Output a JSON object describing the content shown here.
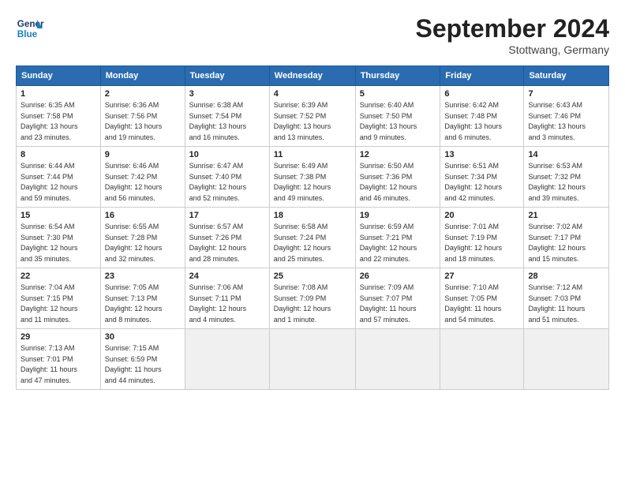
{
  "header": {
    "logo_line1": "General",
    "logo_line2": "Blue",
    "month_title": "September 2024",
    "location": "Stottwang, Germany"
  },
  "weekdays": [
    "Sunday",
    "Monday",
    "Tuesday",
    "Wednesday",
    "Thursday",
    "Friday",
    "Saturday"
  ],
  "weeks": [
    [
      {
        "day": "1",
        "info": "Sunrise: 6:35 AM\nSunset: 7:58 PM\nDaylight: 13 hours\nand 23 minutes."
      },
      {
        "day": "2",
        "info": "Sunrise: 6:36 AM\nSunset: 7:56 PM\nDaylight: 13 hours\nand 19 minutes."
      },
      {
        "day": "3",
        "info": "Sunrise: 6:38 AM\nSunset: 7:54 PM\nDaylight: 13 hours\nand 16 minutes."
      },
      {
        "day": "4",
        "info": "Sunrise: 6:39 AM\nSunset: 7:52 PM\nDaylight: 13 hours\nand 13 minutes."
      },
      {
        "day": "5",
        "info": "Sunrise: 6:40 AM\nSunset: 7:50 PM\nDaylight: 13 hours\nand 9 minutes."
      },
      {
        "day": "6",
        "info": "Sunrise: 6:42 AM\nSunset: 7:48 PM\nDaylight: 13 hours\nand 6 minutes."
      },
      {
        "day": "7",
        "info": "Sunrise: 6:43 AM\nSunset: 7:46 PM\nDaylight: 13 hours\nand 3 minutes."
      }
    ],
    [
      {
        "day": "8",
        "info": "Sunrise: 6:44 AM\nSunset: 7:44 PM\nDaylight: 12 hours\nand 59 minutes."
      },
      {
        "day": "9",
        "info": "Sunrise: 6:46 AM\nSunset: 7:42 PM\nDaylight: 12 hours\nand 56 minutes."
      },
      {
        "day": "10",
        "info": "Sunrise: 6:47 AM\nSunset: 7:40 PM\nDaylight: 12 hours\nand 52 minutes."
      },
      {
        "day": "11",
        "info": "Sunrise: 6:49 AM\nSunset: 7:38 PM\nDaylight: 12 hours\nand 49 minutes."
      },
      {
        "day": "12",
        "info": "Sunrise: 6:50 AM\nSunset: 7:36 PM\nDaylight: 12 hours\nand 46 minutes."
      },
      {
        "day": "13",
        "info": "Sunrise: 6:51 AM\nSunset: 7:34 PM\nDaylight: 12 hours\nand 42 minutes."
      },
      {
        "day": "14",
        "info": "Sunrise: 6:53 AM\nSunset: 7:32 PM\nDaylight: 12 hours\nand 39 minutes."
      }
    ],
    [
      {
        "day": "15",
        "info": "Sunrise: 6:54 AM\nSunset: 7:30 PM\nDaylight: 12 hours\nand 35 minutes."
      },
      {
        "day": "16",
        "info": "Sunrise: 6:55 AM\nSunset: 7:28 PM\nDaylight: 12 hours\nand 32 minutes."
      },
      {
        "day": "17",
        "info": "Sunrise: 6:57 AM\nSunset: 7:26 PM\nDaylight: 12 hours\nand 28 minutes."
      },
      {
        "day": "18",
        "info": "Sunrise: 6:58 AM\nSunset: 7:24 PM\nDaylight: 12 hours\nand 25 minutes."
      },
      {
        "day": "19",
        "info": "Sunrise: 6:59 AM\nSunset: 7:21 PM\nDaylight: 12 hours\nand 22 minutes."
      },
      {
        "day": "20",
        "info": "Sunrise: 7:01 AM\nSunset: 7:19 PM\nDaylight: 12 hours\nand 18 minutes."
      },
      {
        "day": "21",
        "info": "Sunrise: 7:02 AM\nSunset: 7:17 PM\nDaylight: 12 hours\nand 15 minutes."
      }
    ],
    [
      {
        "day": "22",
        "info": "Sunrise: 7:04 AM\nSunset: 7:15 PM\nDaylight: 12 hours\nand 11 minutes."
      },
      {
        "day": "23",
        "info": "Sunrise: 7:05 AM\nSunset: 7:13 PM\nDaylight: 12 hours\nand 8 minutes."
      },
      {
        "day": "24",
        "info": "Sunrise: 7:06 AM\nSunset: 7:11 PM\nDaylight: 12 hours\nand 4 minutes."
      },
      {
        "day": "25",
        "info": "Sunrise: 7:08 AM\nSunset: 7:09 PM\nDaylight: 12 hours\nand 1 minute."
      },
      {
        "day": "26",
        "info": "Sunrise: 7:09 AM\nSunset: 7:07 PM\nDaylight: 11 hours\nand 57 minutes."
      },
      {
        "day": "27",
        "info": "Sunrise: 7:10 AM\nSunset: 7:05 PM\nDaylight: 11 hours\nand 54 minutes."
      },
      {
        "day": "28",
        "info": "Sunrise: 7:12 AM\nSunset: 7:03 PM\nDaylight: 11 hours\nand 51 minutes."
      }
    ],
    [
      {
        "day": "29",
        "info": "Sunrise: 7:13 AM\nSunset: 7:01 PM\nDaylight: 11 hours\nand 47 minutes."
      },
      {
        "day": "30",
        "info": "Sunrise: 7:15 AM\nSunset: 6:59 PM\nDaylight: 11 hours\nand 44 minutes."
      },
      {
        "day": "",
        "info": ""
      },
      {
        "day": "",
        "info": ""
      },
      {
        "day": "",
        "info": ""
      },
      {
        "day": "",
        "info": ""
      },
      {
        "day": "",
        "info": ""
      }
    ]
  ]
}
